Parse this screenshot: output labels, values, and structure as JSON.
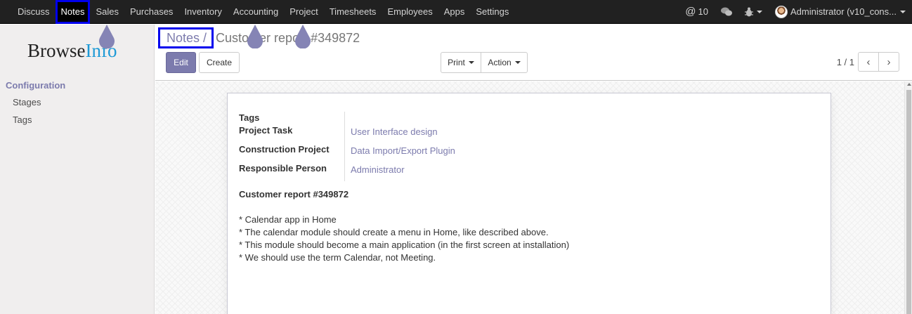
{
  "topnav": {
    "menu": [
      "Discuss",
      "Notes",
      "Sales",
      "Purchases",
      "Inventory",
      "Accounting",
      "Project",
      "Timesheets",
      "Employees",
      "Apps",
      "Settings"
    ],
    "active": "Notes",
    "mentions": "10",
    "user": "Administrator (v10_cons..."
  },
  "sidebar": {
    "logo_a": "Browse",
    "logo_b": "Info",
    "section": "Configuration",
    "items": [
      "Stages",
      "Tags"
    ]
  },
  "control": {
    "breadcrumb_link": "Notes /",
    "breadcrumb_current": "Customer report #349872",
    "edit": "Edit",
    "create": "Create",
    "print": "Print",
    "action": "Action",
    "pager": "1 / 1"
  },
  "form": {
    "fields": [
      {
        "label": "Tags",
        "value": ""
      },
      {
        "label": "Project Task",
        "value": "User Interface design"
      },
      {
        "label": "Construction Project",
        "value": "Data Import/Export Plugin"
      },
      {
        "label": "Responsible Person",
        "value": "Administrator"
      }
    ],
    "title": "Customer report #349872",
    "lines": [
      "* Calendar app in Home",
      "* The calendar module should create a menu in Home, like described above.",
      "* This module should become a main application (in the first screen at installation)",
      "* We should use the term Calendar, not Meeting."
    ]
  },
  "colors": {
    "accent": "#7c7bad",
    "highlight": "#0000ee",
    "topbar": "#212121"
  }
}
